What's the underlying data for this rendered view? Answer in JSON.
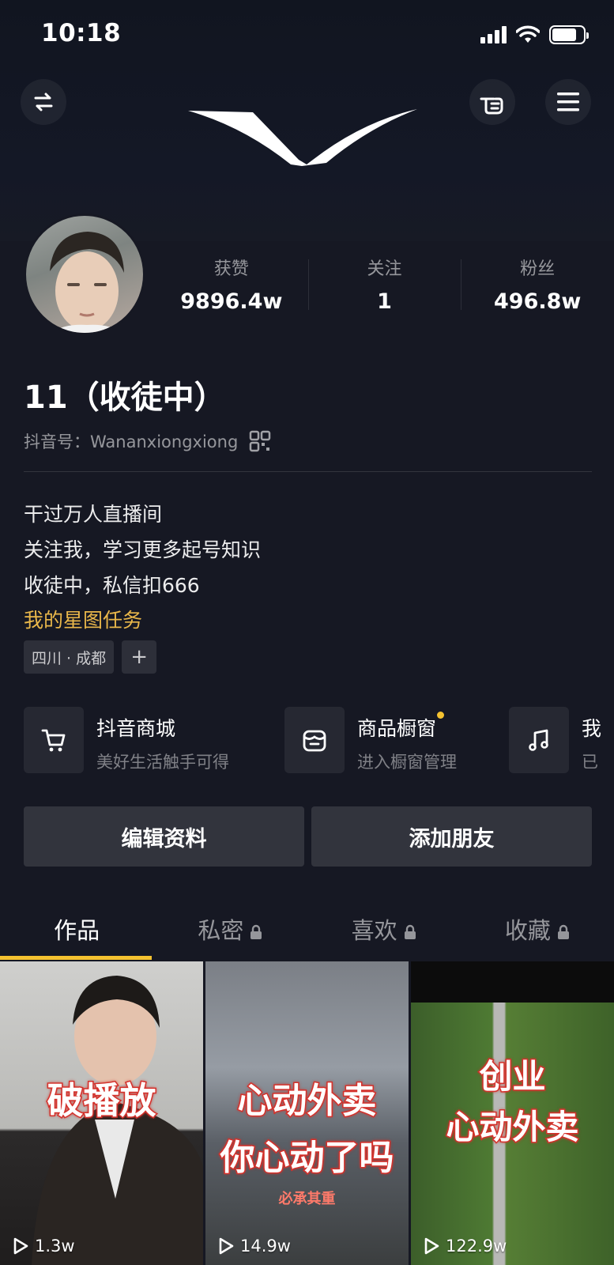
{
  "status_bar": {
    "time": "10:18"
  },
  "profile": {
    "name": "11（收徒中）",
    "account_id": "抖音号：Wananxiongxiong",
    "stats": [
      {
        "label": "获赞",
        "value": "9896.4w"
      },
      {
        "label": "关注",
        "value": "1"
      },
      {
        "label": "粉丝",
        "value": "496.8w"
      }
    ],
    "bio": [
      "干过万人直播间",
      "关注我，学习更多起号知识",
      "收徒中，私信扣666"
    ],
    "task_link": "我的星图任务",
    "tags": [
      "四川 · 成都",
      "+"
    ]
  },
  "services": [
    {
      "title": "抖音商城",
      "subtitle": "美好生活触手可得",
      "icon": "cart-icon"
    },
    {
      "title": "商品橱窗",
      "subtitle": "进入橱窗管理",
      "icon": "store-icon"
    },
    {
      "title": "我",
      "subtitle": "已",
      "icon": "music-icon"
    }
  ],
  "actions": {
    "edit": "编辑资料",
    "add_friend": "添加朋友"
  },
  "tabs": [
    {
      "label": "作品",
      "locked": false
    },
    {
      "label": "私密",
      "locked": true
    },
    {
      "label": "喜欢",
      "locked": true
    },
    {
      "label": "收藏",
      "locked": true
    }
  ],
  "videos": [
    {
      "overlay": "破播放",
      "plays": "1.3w"
    },
    {
      "overlay_line1": "心动外卖",
      "overlay_line2": "你心动了吗",
      "caption": "必承其重",
      "plays": "14.9w"
    },
    {
      "overlay_line1": "创业",
      "overlay_line2": "心动外卖",
      "plays": "122.9w"
    }
  ],
  "colors": {
    "background": "#161823",
    "accent": "#f5c230",
    "link": "#e9b74a",
    "overlay_stroke": "#d4322c"
  }
}
